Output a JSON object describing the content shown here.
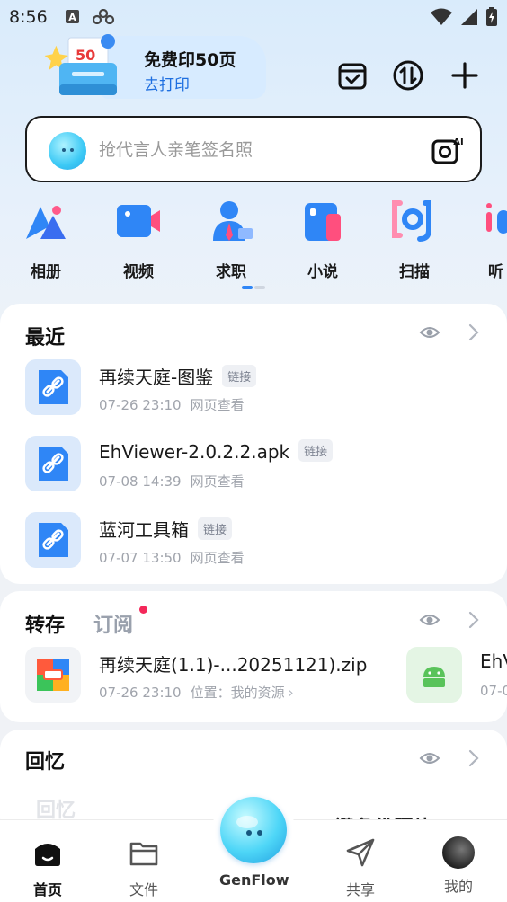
{
  "status_bar": {
    "time": "8:56"
  },
  "promo": {
    "title": "免费印50页",
    "action": "去打印",
    "badge": "50"
  },
  "search": {
    "placeholder": "抢代言人亲笔签名照"
  },
  "apps": [
    {
      "label": "相册",
      "icon": "album-icon"
    },
    {
      "label": "视频",
      "icon": "video-icon"
    },
    {
      "label": "求职",
      "icon": "job-icon"
    },
    {
      "label": "小说",
      "icon": "novel-icon"
    },
    {
      "label": "扫描",
      "icon": "scan-icon"
    },
    {
      "label": "听",
      "icon": "listen-icon"
    }
  ],
  "recent": {
    "title": "最近",
    "items": [
      {
        "name": "再续天庭-图鉴",
        "tag": "链接",
        "time": "07-26 23:10",
        "source": "网页查看"
      },
      {
        "name": "EhViewer-2.0.2.2.apk",
        "tag": "链接",
        "time": "07-08 14:39",
        "source": "网页查看"
      },
      {
        "name": "蓝河工具箱",
        "tag": "链接",
        "time": "07-07 13:50",
        "source": "网页查看"
      }
    ]
  },
  "transfer": {
    "title": "转存",
    "tab2": "订阅",
    "items": [
      {
        "name": "再续天庭(1.1)-...20251121).zip",
        "time": "07-26 23:10",
        "location": "位置：我的资源"
      },
      {
        "name": "EhV",
        "time": "07-0"
      }
    ]
  },
  "memories": {
    "title": "回忆",
    "peek_text": "一键备份照片",
    "stamp": "回忆"
  },
  "nav": {
    "items": [
      {
        "label": "首页"
      },
      {
        "label": "文件"
      },
      {
        "label": "GenFlow"
      },
      {
        "label": "共享"
      },
      {
        "label": "我的"
      }
    ]
  },
  "colors": {
    "accent": "#1e6fe0",
    "notify": "#f4285a"
  }
}
